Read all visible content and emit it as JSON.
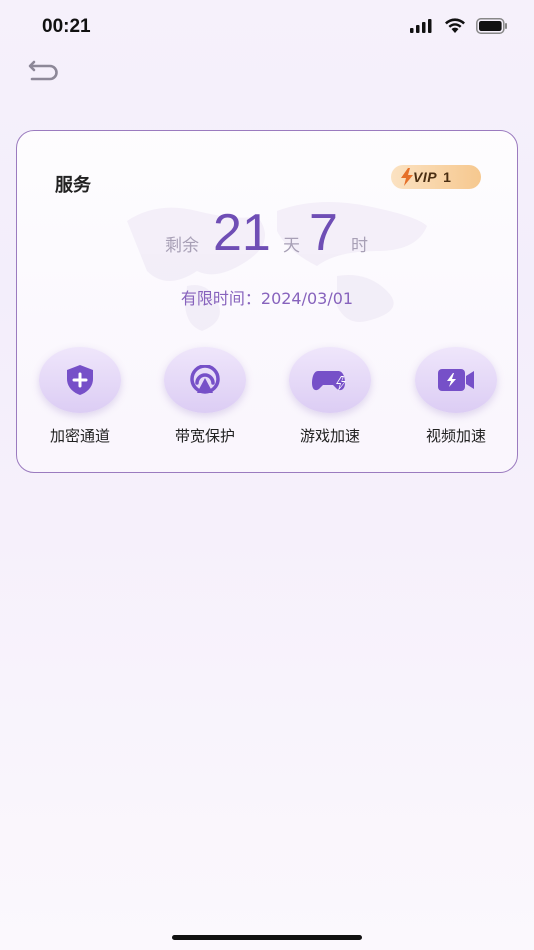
{
  "status_bar": {
    "time": "00:21"
  },
  "card": {
    "title": "服务",
    "vip": {
      "text": "VIP",
      "level": "1"
    },
    "remaining": {
      "prefix": "剩余",
      "days": "21",
      "days_unit": "天",
      "hours": "7",
      "hours_unit": "时"
    },
    "expire_label": "有限时间：",
    "expire_date": "2024/03/01",
    "services": [
      {
        "label": "加密通道",
        "icon": "shield-plus-icon"
      },
      {
        "label": "带宽保护",
        "icon": "broadcast-icon"
      },
      {
        "label": "游戏加速",
        "icon": "gamepad-icon"
      },
      {
        "label": "视频加速",
        "icon": "video-camera-icon"
      }
    ]
  },
  "colors": {
    "accent": "#6f4eb5",
    "border": "#9b7bbf",
    "vip_bg": "#f6c88f"
  }
}
